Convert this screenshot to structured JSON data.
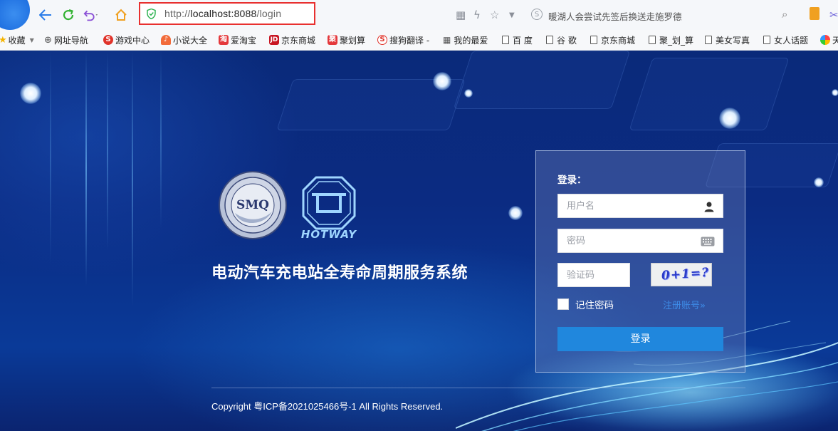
{
  "browser": {
    "url_scheme": "http://",
    "url_host": "localhost:8088",
    "url_path": "/login",
    "search_hint": "暖湖人会尝试先签后换送走施罗德",
    "bookmarks": [
      {
        "label": "收藏",
        "icon": "star-icon"
      },
      {
        "label": "网址导航",
        "icon": "globe-icon"
      },
      {
        "label": "游戏中心",
        "icon": "game-icon"
      },
      {
        "label": "小说大全",
        "icon": "book-icon"
      },
      {
        "label": "爱淘宝",
        "icon": "taobao-icon",
        "badge": "淘"
      },
      {
        "label": "京东商城",
        "icon": "jd-icon",
        "badge": "JD"
      },
      {
        "label": "聚划算",
        "icon": "juhuasuan-icon",
        "badge": "聚"
      },
      {
        "label": "搜狗翻译 -",
        "icon": "sogou-icon",
        "badge": "S"
      },
      {
        "label": "我的最爱",
        "icon": "grid-icon"
      },
      {
        "label": "百 度",
        "icon": "page-icon"
      },
      {
        "label": "谷 歌",
        "icon": "page-icon"
      },
      {
        "label": "京东商城",
        "icon": "page-icon"
      },
      {
        "label": "聚_划_算",
        "icon": "page-icon"
      },
      {
        "label": "美女写真",
        "icon": "page-icon"
      },
      {
        "label": "女人话题",
        "icon": "page-icon"
      },
      {
        "label": "天",
        "icon": "colorful-icon"
      }
    ]
  },
  "page": {
    "seal_text": "SMQ",
    "hotway_text": "HOTWAY",
    "system_title": "电动汽车充电站全寿命周期服务系统",
    "copyright": "Copyright 粤ICP备2021025466号-1 All Rights Reserved."
  },
  "login": {
    "title": "登录：",
    "username_placeholder": "用户名",
    "password_placeholder": "密码",
    "captcha_placeholder": "验证码",
    "captcha_text": "0+1=?",
    "remember_label": "记住密码",
    "register_label": "注册账号»",
    "submit_label": "登录"
  },
  "colors": {
    "address_highlight": "#e8302f",
    "login_button": "#2087dd",
    "register_link": "#3d8ce8"
  }
}
